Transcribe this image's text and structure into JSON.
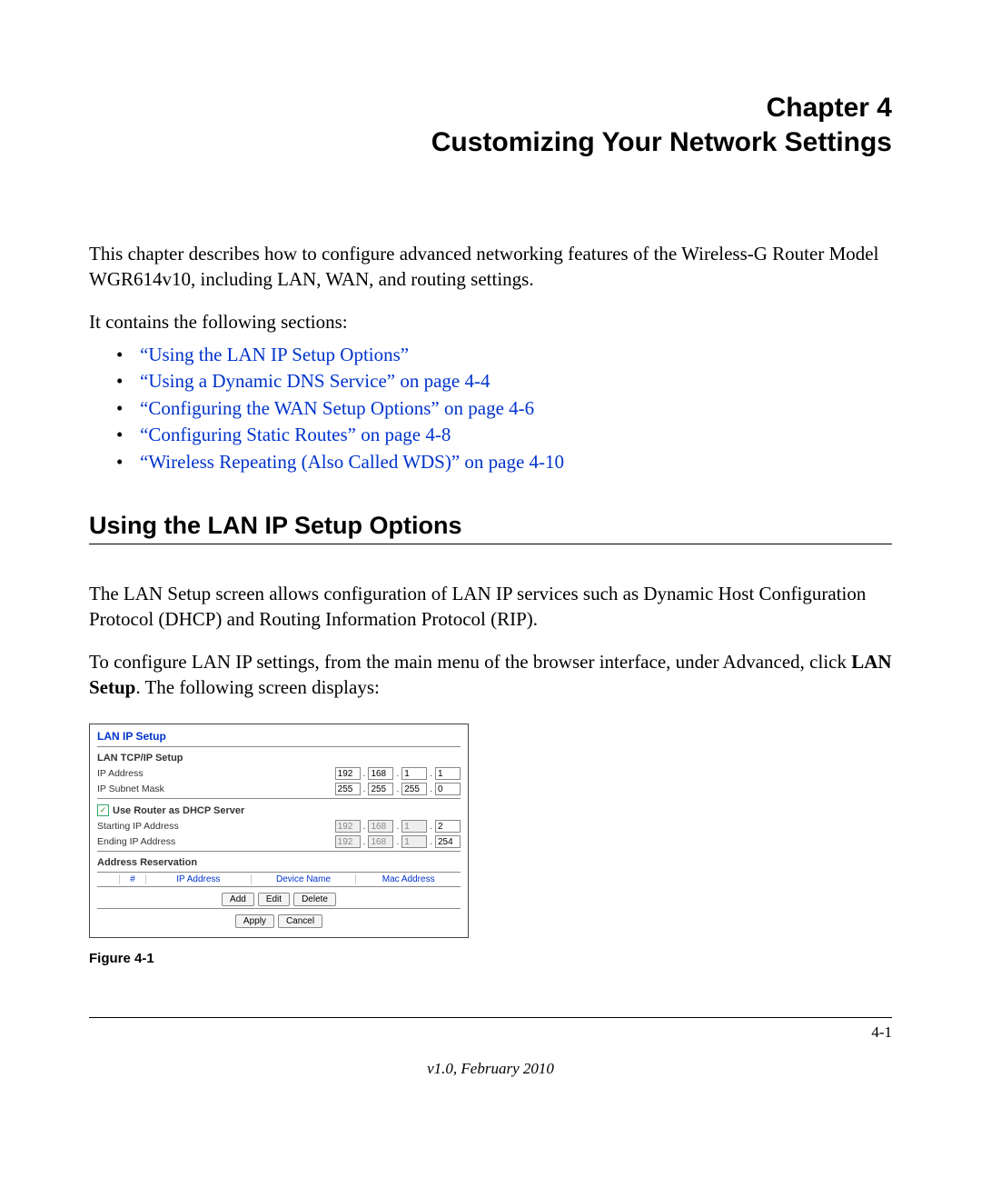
{
  "chapter": {
    "line1": "Chapter 4",
    "line2": "Customizing Your Network Settings"
  },
  "intro": "This chapter describes how to configure advanced networking features of the Wireless-G Router Model WGR614v10, including LAN, WAN, and routing settings.",
  "contains": "It contains the following sections:",
  "toc": [
    "“Using the LAN IP Setup Options”",
    "“Using a Dynamic DNS Service” on page 4-4",
    "“Configuring the WAN Setup Options” on page 4-6",
    "“Configuring Static Routes” on page 4-8",
    "“Wireless Repeating (Also Called WDS)” on page 4-10"
  ],
  "section_heading": "Using the LAN IP Setup Options",
  "section_p1": "The LAN Setup screen allows configuration of LAN IP services such as Dynamic Host Configuration Protocol (DHCP) and Routing Information Protocol (RIP).",
  "section_p2a": "To configure LAN IP settings, from the main menu of the browser interface, under Advanced, click ",
  "section_p2_bold": "LAN Setup",
  "section_p2b": ". The following screen displays:",
  "figure_caption": "Figure 4-1",
  "page_number": "4-1",
  "version_line": "v1.0, February 2010",
  "shot": {
    "title": "LAN IP Setup",
    "group_tcpip": "LAN TCP/IP Setup",
    "ip_label": "IP Address",
    "ip": [
      "192",
      "168",
      "1",
      "1"
    ],
    "mask_label": "IP Subnet Mask",
    "mask": [
      "255",
      "255",
      "255",
      "0"
    ],
    "dhcp_check_label": "Use Router as DHCP Server",
    "start_label": "Starting IP Address",
    "start": [
      "192",
      "168",
      "1",
      "2"
    ],
    "end_label": "Ending IP Address",
    "end": [
      "192",
      "168",
      "1",
      "254"
    ],
    "res_label": "Address Reservation",
    "res_heads": {
      "num": "#",
      "ip": "IP Address",
      "dev": "Device Name",
      "mac": "Mac Address"
    },
    "buttons": {
      "add": "Add",
      "edit": "Edit",
      "delete": "Delete",
      "apply": "Apply",
      "cancel": "Cancel"
    }
  }
}
